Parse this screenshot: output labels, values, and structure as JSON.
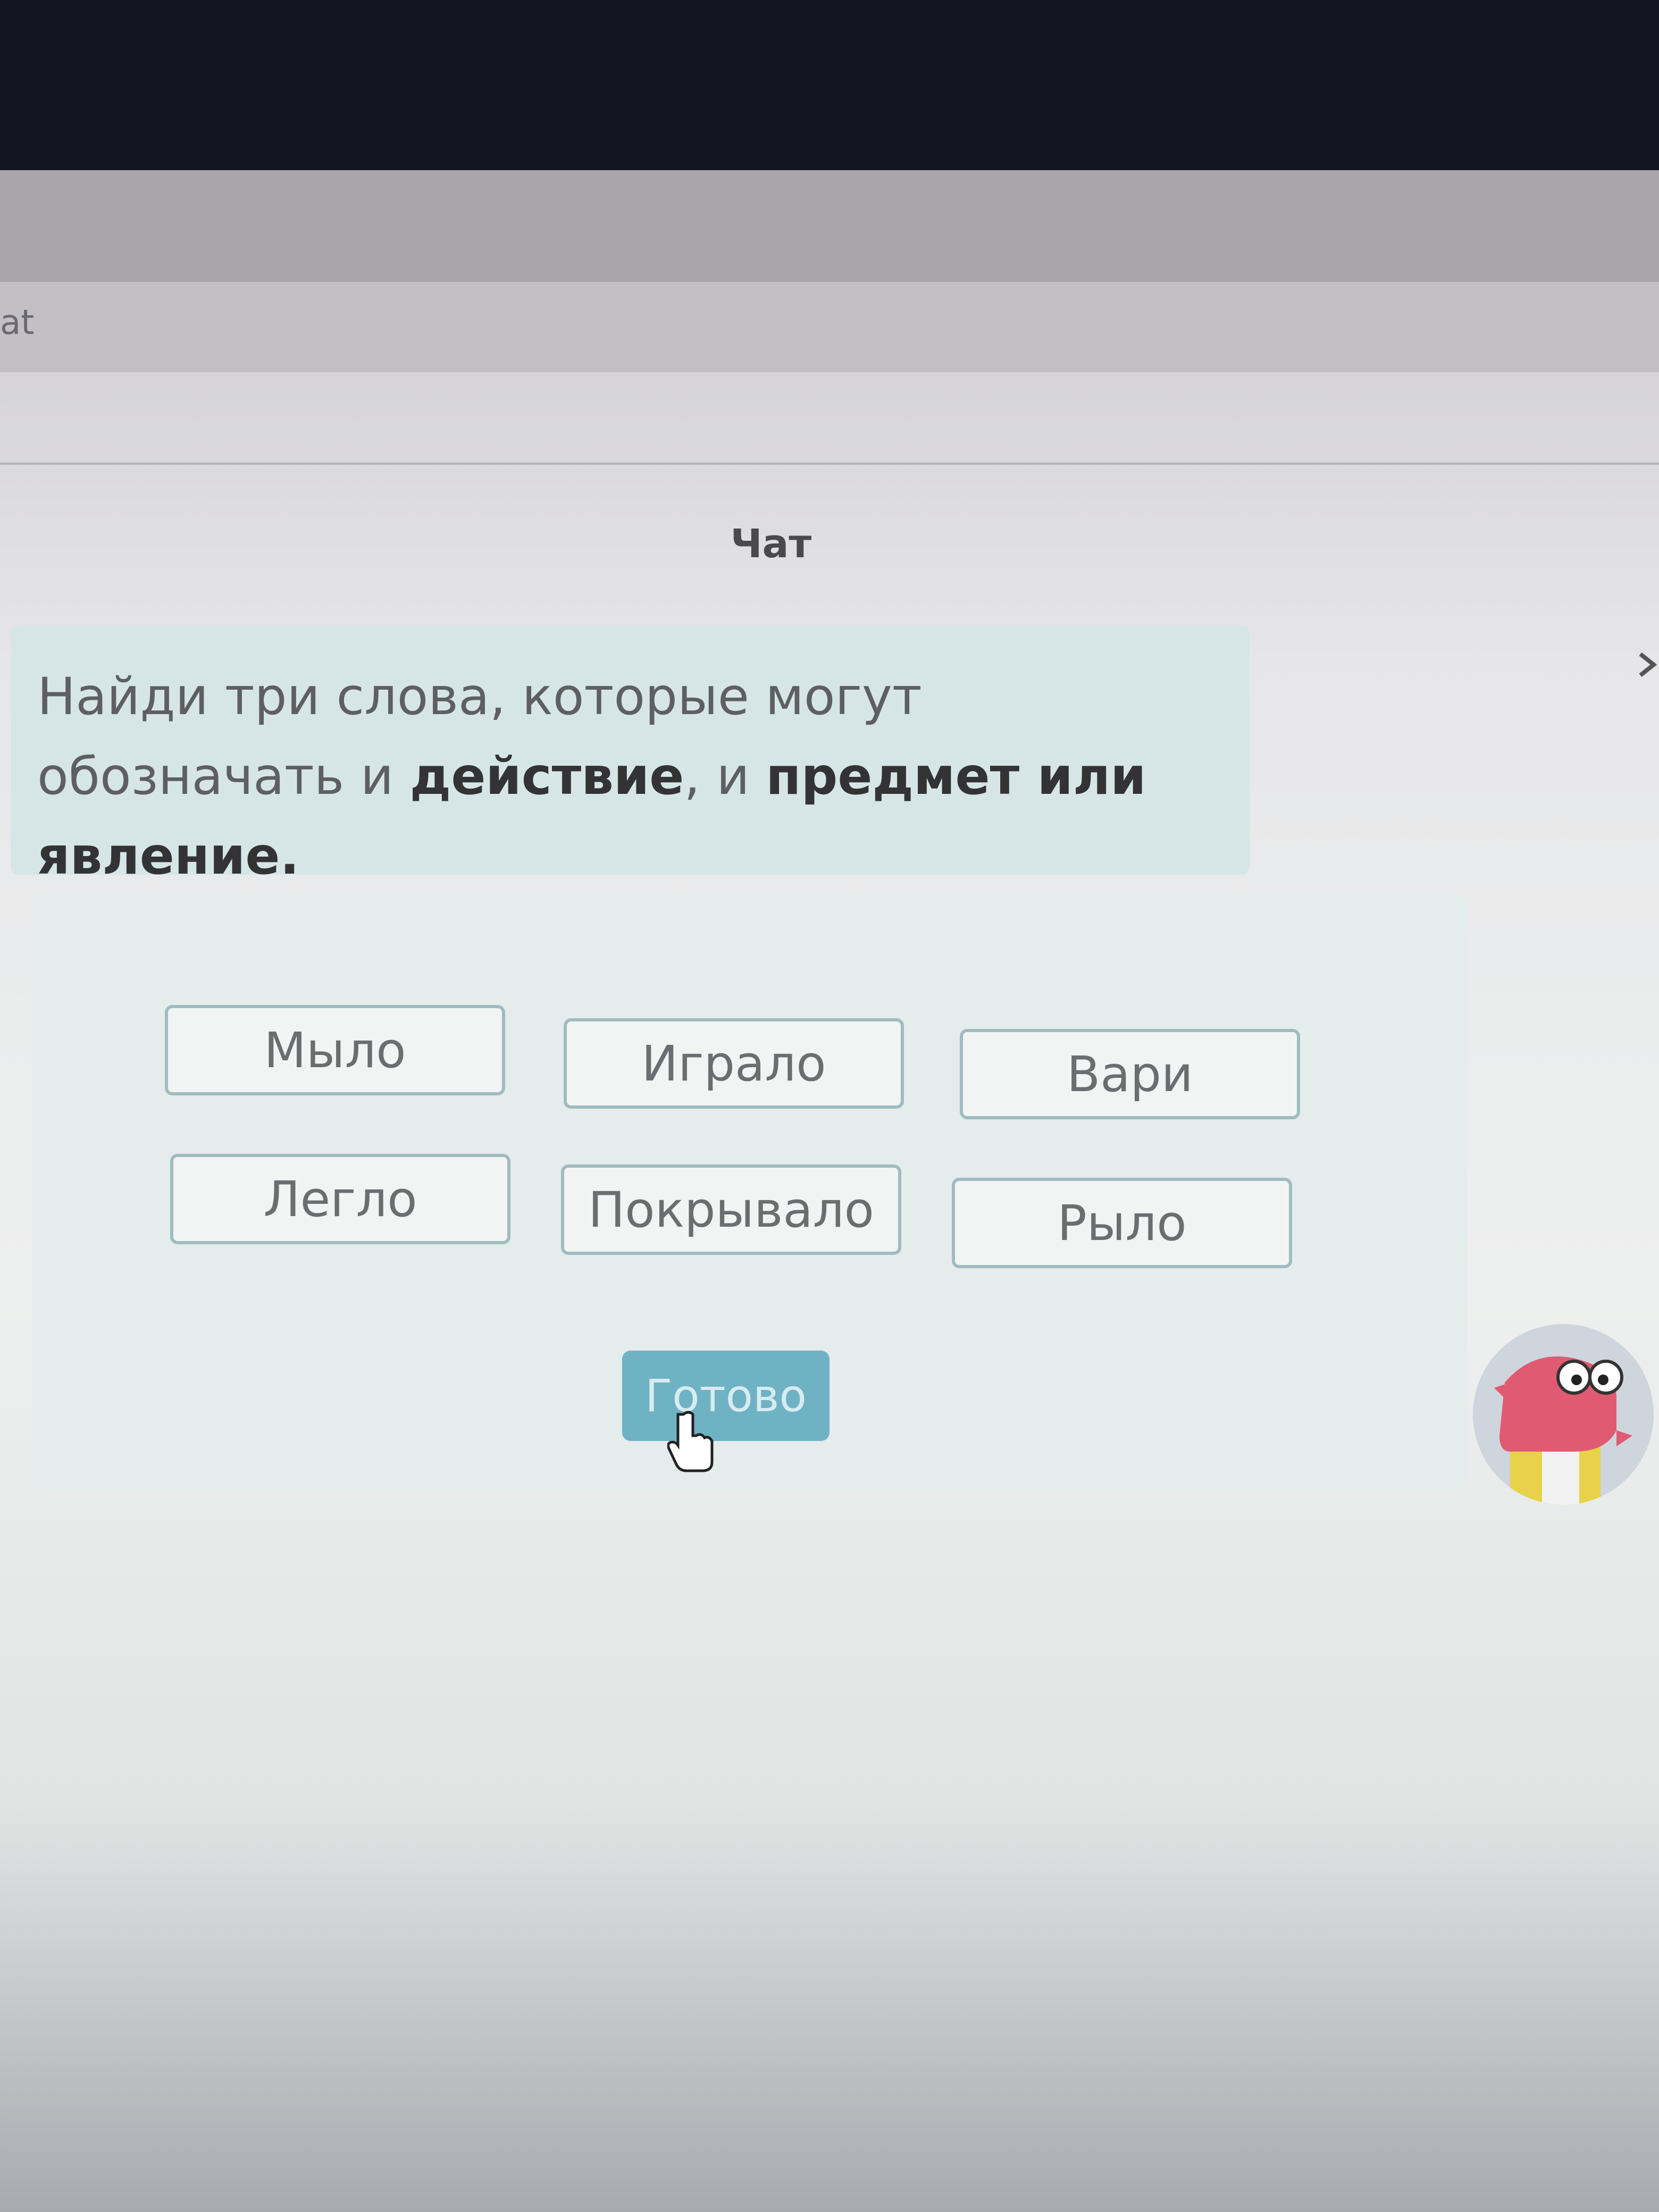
{
  "browser": {
    "tab_label": "at"
  },
  "header": {
    "title": "Чат"
  },
  "question": {
    "prefix": "Найди три слова, которые могут обозначать и ",
    "bold_1": "действие",
    "middle": ", и ",
    "bold_2": "предмет или явление."
  },
  "answers": {
    "options": [
      "Мыло",
      "Играло",
      "Вари",
      "Легло",
      "Покрывало",
      "Рыло"
    ]
  },
  "actions": {
    "done_label": "Готово"
  },
  "colors": {
    "accent": "#6fb2c3",
    "card_border": "#9fbcc0",
    "question_bg": "#d6e6e6"
  },
  "icons": {
    "cursor": "hand-pointer-icon",
    "mascot": "dinosaur-mascot-icon",
    "chevron": "chevron-right-icon"
  }
}
